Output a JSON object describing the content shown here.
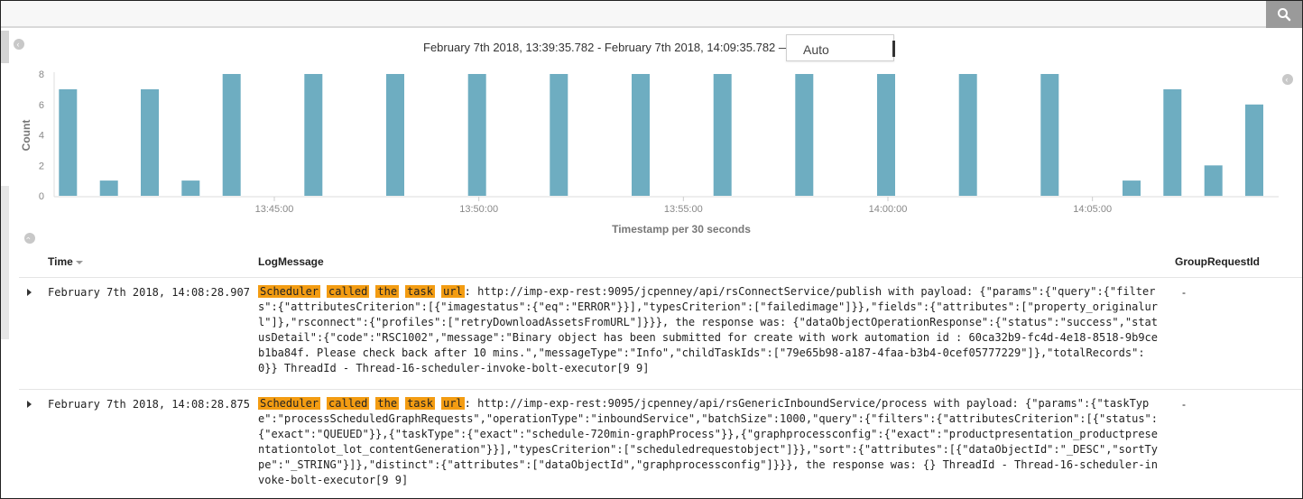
{
  "header": {
    "time_range": "February 7th 2018, 13:39:35.782 - February 7th 2018, 14:09:35.782 —",
    "interval": "Auto"
  },
  "chart_data": {
    "type": "bar",
    "bar_color": "#6eadc1",
    "xlabel": "Timestamp per 30 seconds",
    "ylabel": "Count",
    "ylim": [
      0,
      8
    ],
    "yticks": [
      "0",
      "2",
      "4",
      "6",
      "8"
    ],
    "xticks": [
      "13:45:00",
      "13:50:00",
      "13:55:00",
      "14:00:00",
      "14:05:00"
    ],
    "categories": [
      "13:40:00",
      "13:40:30",
      "13:41:00",
      "13:41:30",
      "13:42:00",
      "13:42:30",
      "13:43:00",
      "13:43:30",
      "13:44:00",
      "13:44:30",
      "13:45:00",
      "13:45:30",
      "13:46:00",
      "13:46:30",
      "13:47:00",
      "13:47:30",
      "13:48:00",
      "13:48:30",
      "13:49:00",
      "13:49:30",
      "13:50:00",
      "13:50:30",
      "13:51:00",
      "13:51:30",
      "13:52:00",
      "13:52:30",
      "13:53:00",
      "13:53:30",
      "13:54:00",
      "13:54:30",
      "13:55:00",
      "13:55:30",
      "13:56:00",
      "13:56:30",
      "13:57:00",
      "13:57:30",
      "13:58:00",
      "13:58:30",
      "13:59:00",
      "13:59:30",
      "14:00:00",
      "14:00:30",
      "14:01:00",
      "14:01:30",
      "14:02:00",
      "14:02:30",
      "14:03:00",
      "14:03:30",
      "14:04:00",
      "14:04:30",
      "14:05:00",
      "14:05:30",
      "14:06:00",
      "14:06:30",
      "14:07:00",
      "14:07:30",
      "14:08:00"
    ],
    "values": [
      7,
      0,
      1,
      0,
      7,
      0,
      1,
      0,
      8,
      0,
      0,
      0,
      8,
      0,
      0,
      0,
      8,
      0,
      0,
      0,
      8,
      0,
      0,
      0,
      8,
      0,
      0,
      0,
      8,
      0,
      0,
      0,
      8,
      0,
      0,
      0,
      8,
      0,
      0,
      0,
      8,
      0,
      0,
      0,
      8,
      0,
      0,
      0,
      8,
      0,
      0,
      0,
      1,
      0,
      7,
      0,
      2,
      0,
      6
    ]
  },
  "table": {
    "columns": {
      "time": "Time",
      "log": "LogMessage",
      "group": "GroupRequestId"
    },
    "highlight_terms": [
      "Scheduler",
      "called",
      "the",
      "task",
      "url"
    ],
    "rows": [
      {
        "time": "February 7th 2018, 14:08:28.907",
        "log": ": http://imp-exp-rest:9095/jcpenney/api/rsConnectService/publish with payload: {\"params\":{\"query\":{\"filters\":{\"attributesCriterion\":[{\"imagestatus\":{\"eq\":\"ERROR\"}}],\"typesCriterion\":[\"failedimage\"]}},\"fields\":{\"attributes\":[\"property_originalurl\"]},\"rsconnect\":{\"profiles\":[\"retryDownloadAssetsFromURL\"]}}}, the response was: {\"dataObjectOperationResponse\":{\"status\":\"success\",\"statusDetail\":{\"code\":\"RSC1002\",\"message\":\"Binary object has been submitted for create with work automation id : 60ca32b9-fc4d-4e18-8518-9b9ceb1ba84f. Please check back after 10 mins.\",\"messageType\":\"Info\",\"childTaskIds\":[\"79e65b98-a187-4faa-b3b4-0cef05777229\"]},\"totalRecords\":0}} ThreadId - Thread-16-scheduler-invoke-bolt-executor[9 9]",
        "group": "-"
      },
      {
        "time": "February 7th 2018, 14:08:28.875",
        "log": ": http://imp-exp-rest:9095/jcpenney/api/rsGenericInboundService/process with payload: {\"params\":{\"taskType\":\"processScheduledGraphRequests\",\"operationType\":\"inboundService\",\"batchSize\":1000,\"query\":{\"filters\":{\"attributesCriterion\":[{\"status\":{\"exact\":\"QUEUED\"}},{\"taskType\":{\"exact\":\"schedule-720min-graphProcess\"}},{\"graphprocessconfig\":{\"exact\":\"productpresentation_productpresentationtolot_lot_contentGeneration\"}}],\"typesCriterion\":[\"scheduledrequestobject\"]}},\"sort\":{\"attributes\":[{\"dataObjectId\":\"_DESC\",\"sortType\":\"_STRING\"}]},\"distinct\":{\"attributes\":[\"dataObjectId\",\"graphprocessconfig\"]}}}, the response was: {} ThreadId - Thread-16-scheduler-invoke-bolt-executor[9 9]",
        "group": "-"
      }
    ]
  }
}
